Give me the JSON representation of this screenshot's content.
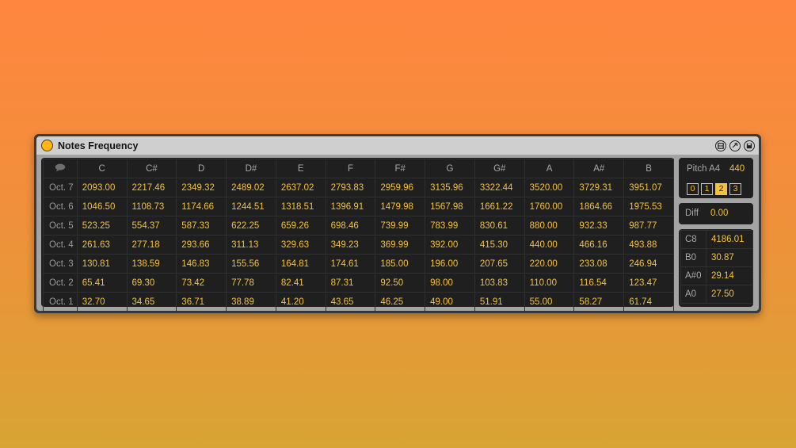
{
  "device": {
    "title": "Notes Frequency",
    "accent_color": "#f5c233"
  },
  "table": {
    "headers": [
      "C",
      "C#",
      "D",
      "D#",
      "E",
      "F",
      "F#",
      "G",
      "G#",
      "A",
      "A#",
      "B"
    ],
    "rows": [
      {
        "label": "Oct. 7",
        "values": [
          "2093.00",
          "2217.46",
          "2349.32",
          "2489.02",
          "2637.02",
          "2793.83",
          "2959.96",
          "3135.96",
          "3322.44",
          "3520.00",
          "3729.31",
          "3951.07"
        ]
      },
      {
        "label": "Oct. 6",
        "values": [
          "1046.50",
          "1108.73",
          "1174.66",
          "1244.51",
          "1318.51",
          "1396.91",
          "1479.98",
          "1567.98",
          "1661.22",
          "1760.00",
          "1864.66",
          "1975.53"
        ]
      },
      {
        "label": "Oct. 5",
        "values": [
          "523.25",
          "554.37",
          "587.33",
          "622.25",
          "659.26",
          "698.46",
          "739.99",
          "783.99",
          "830.61",
          "880.00",
          "932.33",
          "987.77"
        ]
      },
      {
        "label": "Oct. 4",
        "values": [
          "261.63",
          "277.18",
          "293.66",
          "311.13",
          "329.63",
          "349.23",
          "369.99",
          "392.00",
          "415.30",
          "440.00",
          "466.16",
          "493.88"
        ]
      },
      {
        "label": "Oct. 3",
        "values": [
          "130.81",
          "138.59",
          "146.83",
          "155.56",
          "164.81",
          "174.61",
          "185.00",
          "196.00",
          "207.65",
          "220.00",
          "233.08",
          "246.94"
        ]
      },
      {
        "label": "Oct. 2",
        "values": [
          "65.41",
          "69.30",
          "73.42",
          "77.78",
          "82.41",
          "87.31",
          "92.50",
          "98.00",
          "103.83",
          "110.00",
          "116.54",
          "123.47"
        ]
      },
      {
        "label": "Oct. 1",
        "values": [
          "32.70",
          "34.65",
          "36.71",
          "38.89",
          "41.20",
          "43.65",
          "46.25",
          "49.00",
          "51.91",
          "55.00",
          "58.27",
          "61.74"
        ]
      }
    ]
  },
  "pitch": {
    "label": "Pitch A4",
    "value": "440",
    "buttons": [
      "0",
      "1",
      "2",
      "3"
    ],
    "active_index": 2
  },
  "diff": {
    "label": "Diff",
    "value": "0.00"
  },
  "reference": [
    {
      "label": "C8",
      "value": "4186.01"
    },
    {
      "label": "B0",
      "value": "30.87"
    },
    {
      "label": "A#0",
      "value": "29.14"
    },
    {
      "label": "A0",
      "value": "27.50"
    }
  ]
}
